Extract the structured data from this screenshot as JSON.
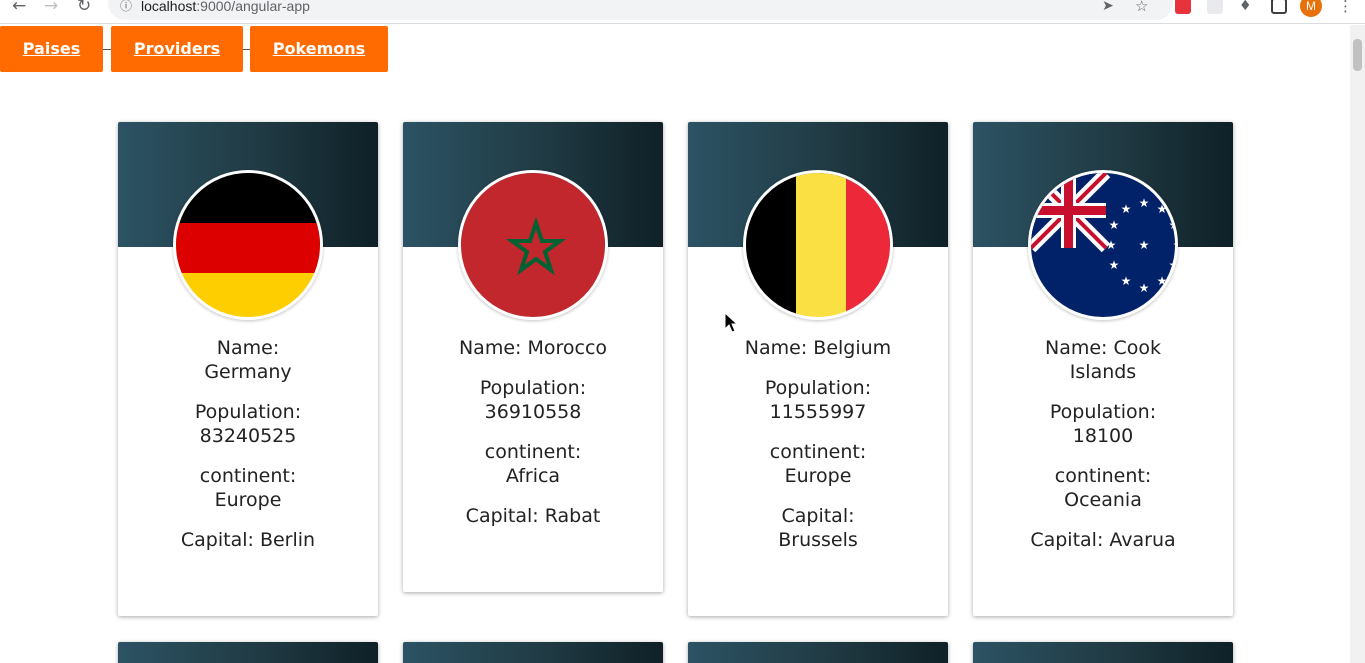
{
  "browser": {
    "url_host": "localhost",
    "url_rest": ":9000/angular-app",
    "profile_initial": "M",
    "colors": {
      "avatar": "#e8710a",
      "abp": "#e8323c"
    }
  },
  "nav": {
    "buttons": [
      {
        "label": "Paises"
      },
      {
        "label": "Providers"
      },
      {
        "label": "Pokemons"
      }
    ],
    "color": "#ff6b00"
  },
  "cards": [
    {
      "flag": "germany-flag",
      "name": "Name: Germany",
      "population": "Population: 83240525",
      "continent": "continent: Europe",
      "capital": "Capital: Berlin"
    },
    {
      "flag": "morocco-flag",
      "name": "Name: Morocco",
      "population": "Population: 36910558",
      "continent": "continent: Africa",
      "capital": "Capital: Rabat"
    },
    {
      "flag": "belgium-flag",
      "name": "Name: Belgium",
      "population": "Population: 11555997",
      "continent": "continent: Europe",
      "capital": "Capital: Brussels"
    },
    {
      "flag": "cook-islands-flag",
      "name": "Name: Cook Islands",
      "population": "Population: 18100",
      "continent": "continent: Oceania",
      "capital": "Capital: Avarua"
    }
  ],
  "colors": {
    "banner_start": "#2c5364",
    "banner_end": "#0f2027"
  }
}
